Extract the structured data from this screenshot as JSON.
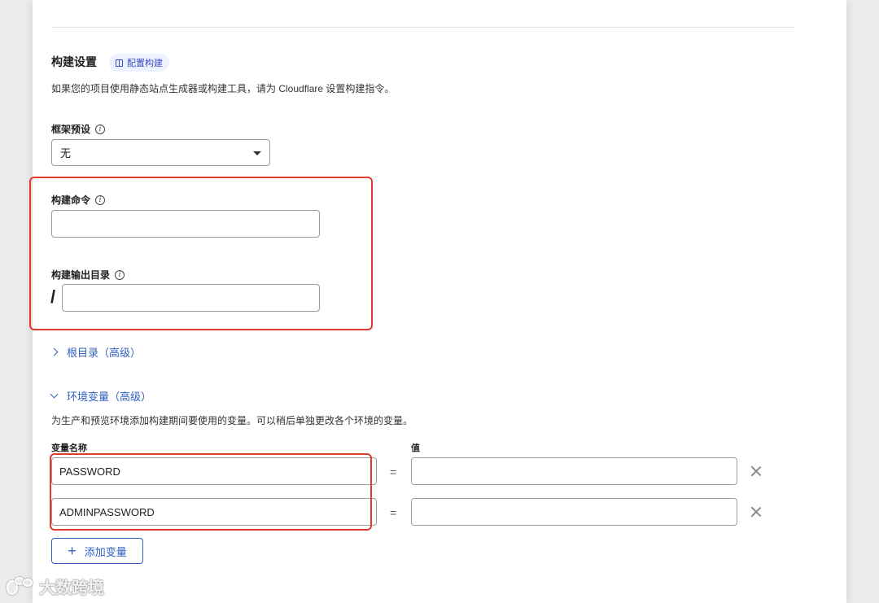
{
  "build_settings": {
    "title": "构建设置",
    "config_badge": "配置构建",
    "description": "如果您的项目使用静态站点生成器或构建工具，请为 Cloudflare 设置构建指令。"
  },
  "framework_preset": {
    "label": "框架预设",
    "selected": "无"
  },
  "build_command": {
    "label": "构建命令",
    "value": ""
  },
  "output_dir": {
    "label": "构建输出目录",
    "prefix": "/",
    "value": ""
  },
  "root_dir": {
    "label": "根目录（高级）"
  },
  "env_vars": {
    "label": "环境变量（高级）",
    "description": "为生产和预览环境添加构建期间要使用的变量。可以稍后单独更改各个环境的变量。",
    "name_header": "变量名称",
    "value_header": "值",
    "equals": "=",
    "rows": [
      {
        "name": "PASSWORD",
        "value": ""
      },
      {
        "name": "ADMINPASSWORD",
        "value": ""
      }
    ],
    "add_label": "添加变量"
  },
  "watermark": "大数跨境",
  "colors": {
    "accent": "#2f5fc1",
    "highlight": "#e23a2f",
    "badge_bg": "#eef1ff"
  }
}
